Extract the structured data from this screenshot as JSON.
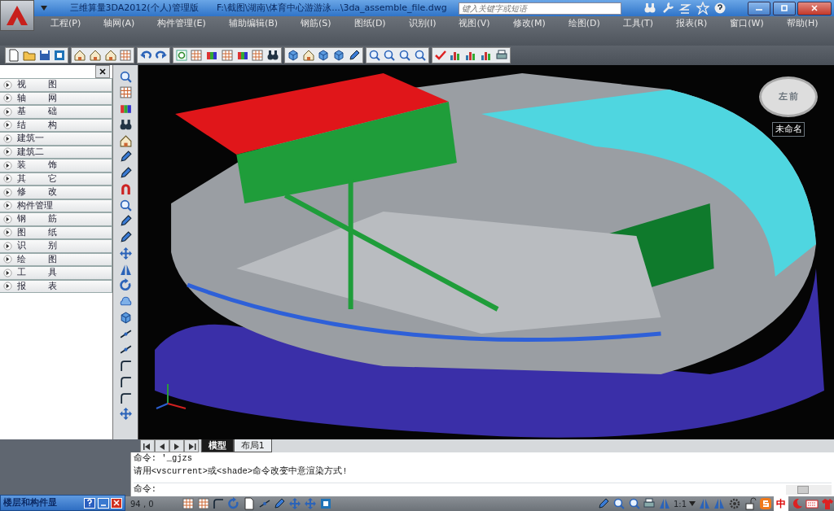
{
  "title_bar": {
    "app_title": "三维算量3DA2012(个人)管理版",
    "file_path": "F:\\截图\\湖南\\体育中心游游泳...\\3da_assemble_file.dwg",
    "search": {
      "placeholder": "键入关键字或短语"
    }
  },
  "menu_bar": {
    "items": [
      "工程(P)",
      "轴网(A)",
      "构件管理(E)",
      "辅助编辑(B)",
      "钢筋(S)",
      "图纸(D)",
      "识别(I)",
      "视图(V)",
      "修改(M)",
      "绘图(D)",
      "工具(T)",
      "报表(R)",
      "窗口(W)",
      "帮助(H)"
    ]
  },
  "side_panel": {
    "items": [
      {
        "label": "视图",
        "expanded": false
      },
      {
        "label": "轴网",
        "expanded": false
      },
      {
        "label": "基础",
        "expanded": false
      },
      {
        "label": "结构",
        "expanded": false
      },
      {
        "label": "建筑一",
        "expanded": false
      },
      {
        "label": "建筑二",
        "expanded": false
      },
      {
        "label": "装饰",
        "expanded": false
      },
      {
        "label": "其它",
        "expanded": false
      },
      {
        "label": "修改",
        "expanded": false
      },
      {
        "label": "构件管理",
        "expanded": false
      },
      {
        "label": "钢筋",
        "expanded": false
      },
      {
        "label": "图纸",
        "expanded": false
      },
      {
        "label": "识别",
        "expanded": false
      },
      {
        "label": "绘图",
        "expanded": false
      },
      {
        "label": "工具",
        "expanded": false
      },
      {
        "label": "报表",
        "expanded": false
      }
    ]
  },
  "viewcube": {
    "faces": [
      "左",
      "前"
    ],
    "view_name": "未命名"
  },
  "layout_tabs": [
    {
      "label": "模型",
      "selected": true
    },
    {
      "label": "布局1",
      "selected": false
    }
  ],
  "command_line": {
    "history": [
      "命令: '_gjzs",
      "请用<vscurrent>或<shade>命令改变中意渲染方式!"
    ],
    "prompt": "命令:"
  },
  "floating_panel": {
    "title": "楼层和构件显"
  },
  "status_bar": {
    "coordinates": "94 , 0",
    "annotation_scale": "1:1",
    "ime": "中"
  }
}
